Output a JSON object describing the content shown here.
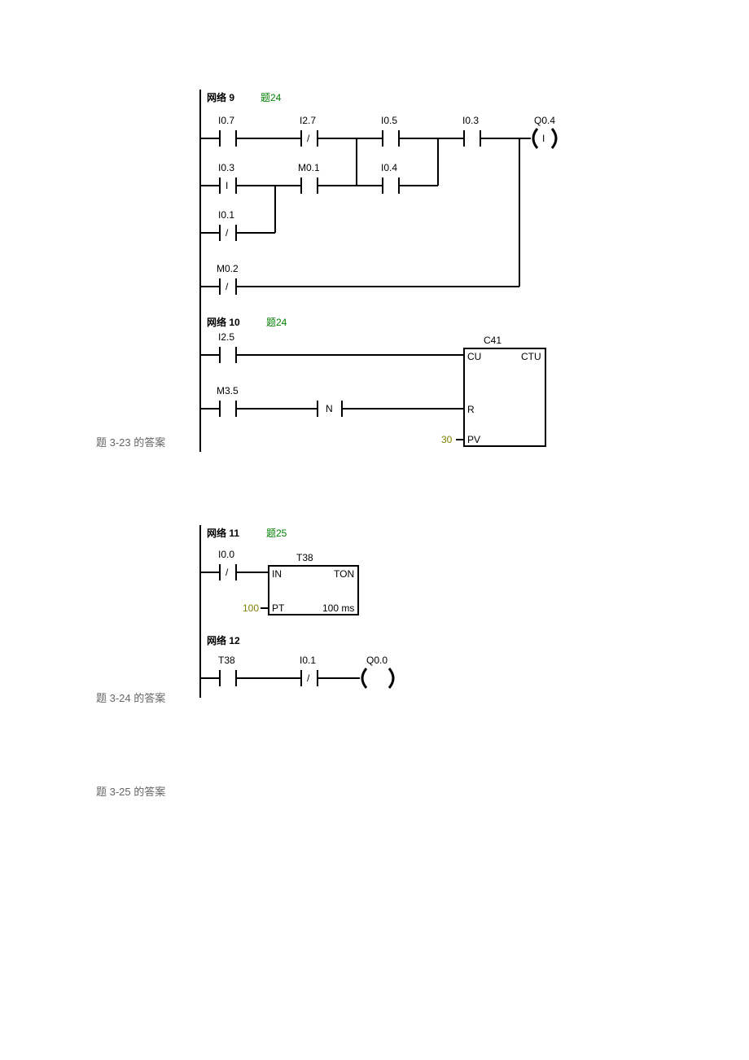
{
  "captions": {
    "c1": "题 3-23 的答案",
    "c2": "题 3-24 的答案",
    "c3": "题 3-25 的答案"
  },
  "net9": {
    "title": "网络 9",
    "comment": "题24",
    "r1": {
      "c1": "I0.7",
      "c2": "I2.7",
      "c3": "I0.5",
      "c4": "I0.3",
      "out": "Q0.4"
    },
    "r2": {
      "c1": "I0.3",
      "c2": "M0.1",
      "c3": "I0.4"
    },
    "r3": {
      "c1": "I0.1"
    },
    "r4": {
      "c1": "M0.2"
    }
  },
  "net10": {
    "title": "网络 10",
    "comment": "题24",
    "r1": {
      "c1": "I2.5"
    },
    "r2": {
      "c1": "M3.5"
    },
    "box": {
      "name": "C41",
      "type": "CTU",
      "cu": "CU",
      "r": "R",
      "pv": "PV",
      "pvval": "30"
    },
    "ntrans": "N"
  },
  "net11": {
    "title": "网络 11",
    "comment": "题25",
    "r1": {
      "c1": "I0.0"
    },
    "box": {
      "name": "T38",
      "type": "TON",
      "in": "IN",
      "pt": "PT",
      "ptval": "100",
      "unit": "100 ms"
    }
  },
  "net12": {
    "title": "网络 12",
    "r1": {
      "c1": "T38",
      "c2": "I0.1",
      "out": "Q0.0"
    }
  }
}
